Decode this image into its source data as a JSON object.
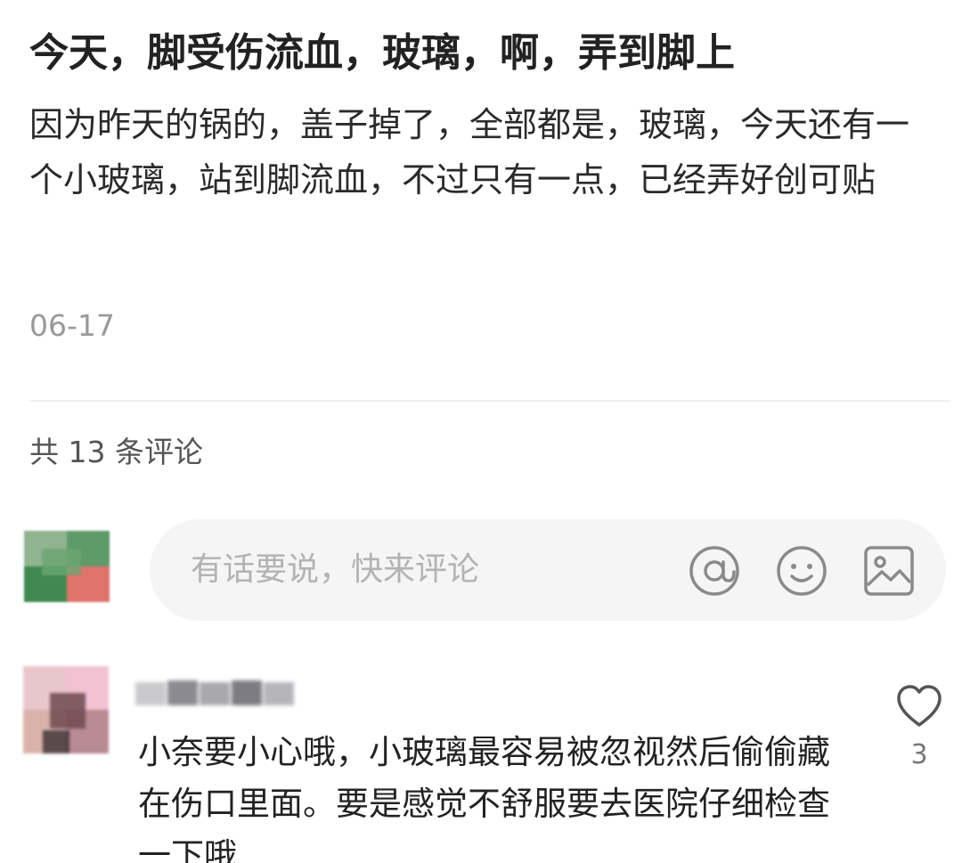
{
  "post": {
    "title": "今天，脚受伤流血，玻璃，啊，弄到脚上",
    "body": "因为昨天的锅的，盖子掉了，全部都是，玻璃，今天还有一个小玻璃，站到脚流血，不过只有一点，已经弄好创可贴",
    "date": "06-17"
  },
  "comments": {
    "count_label": "共 13 条评论",
    "input": {
      "placeholder": "有话要说，快来评论",
      "icons": [
        "at-icon",
        "emoji-icon",
        "image-icon"
      ]
    },
    "items": [
      {
        "text": "小奈要小心哦，小玻璃最容易被忽视然后偷偷藏在伤口里面。要是感觉不舒服要去医院仔细检查一下哦",
        "like_count": "3",
        "like_icon": "heart-icon"
      }
    ]
  },
  "colors": {
    "text_primary": "#222222",
    "text_secondary": "#999999",
    "input_bg": "#f5f5f5",
    "icon_gray": "#8a8a8a"
  }
}
